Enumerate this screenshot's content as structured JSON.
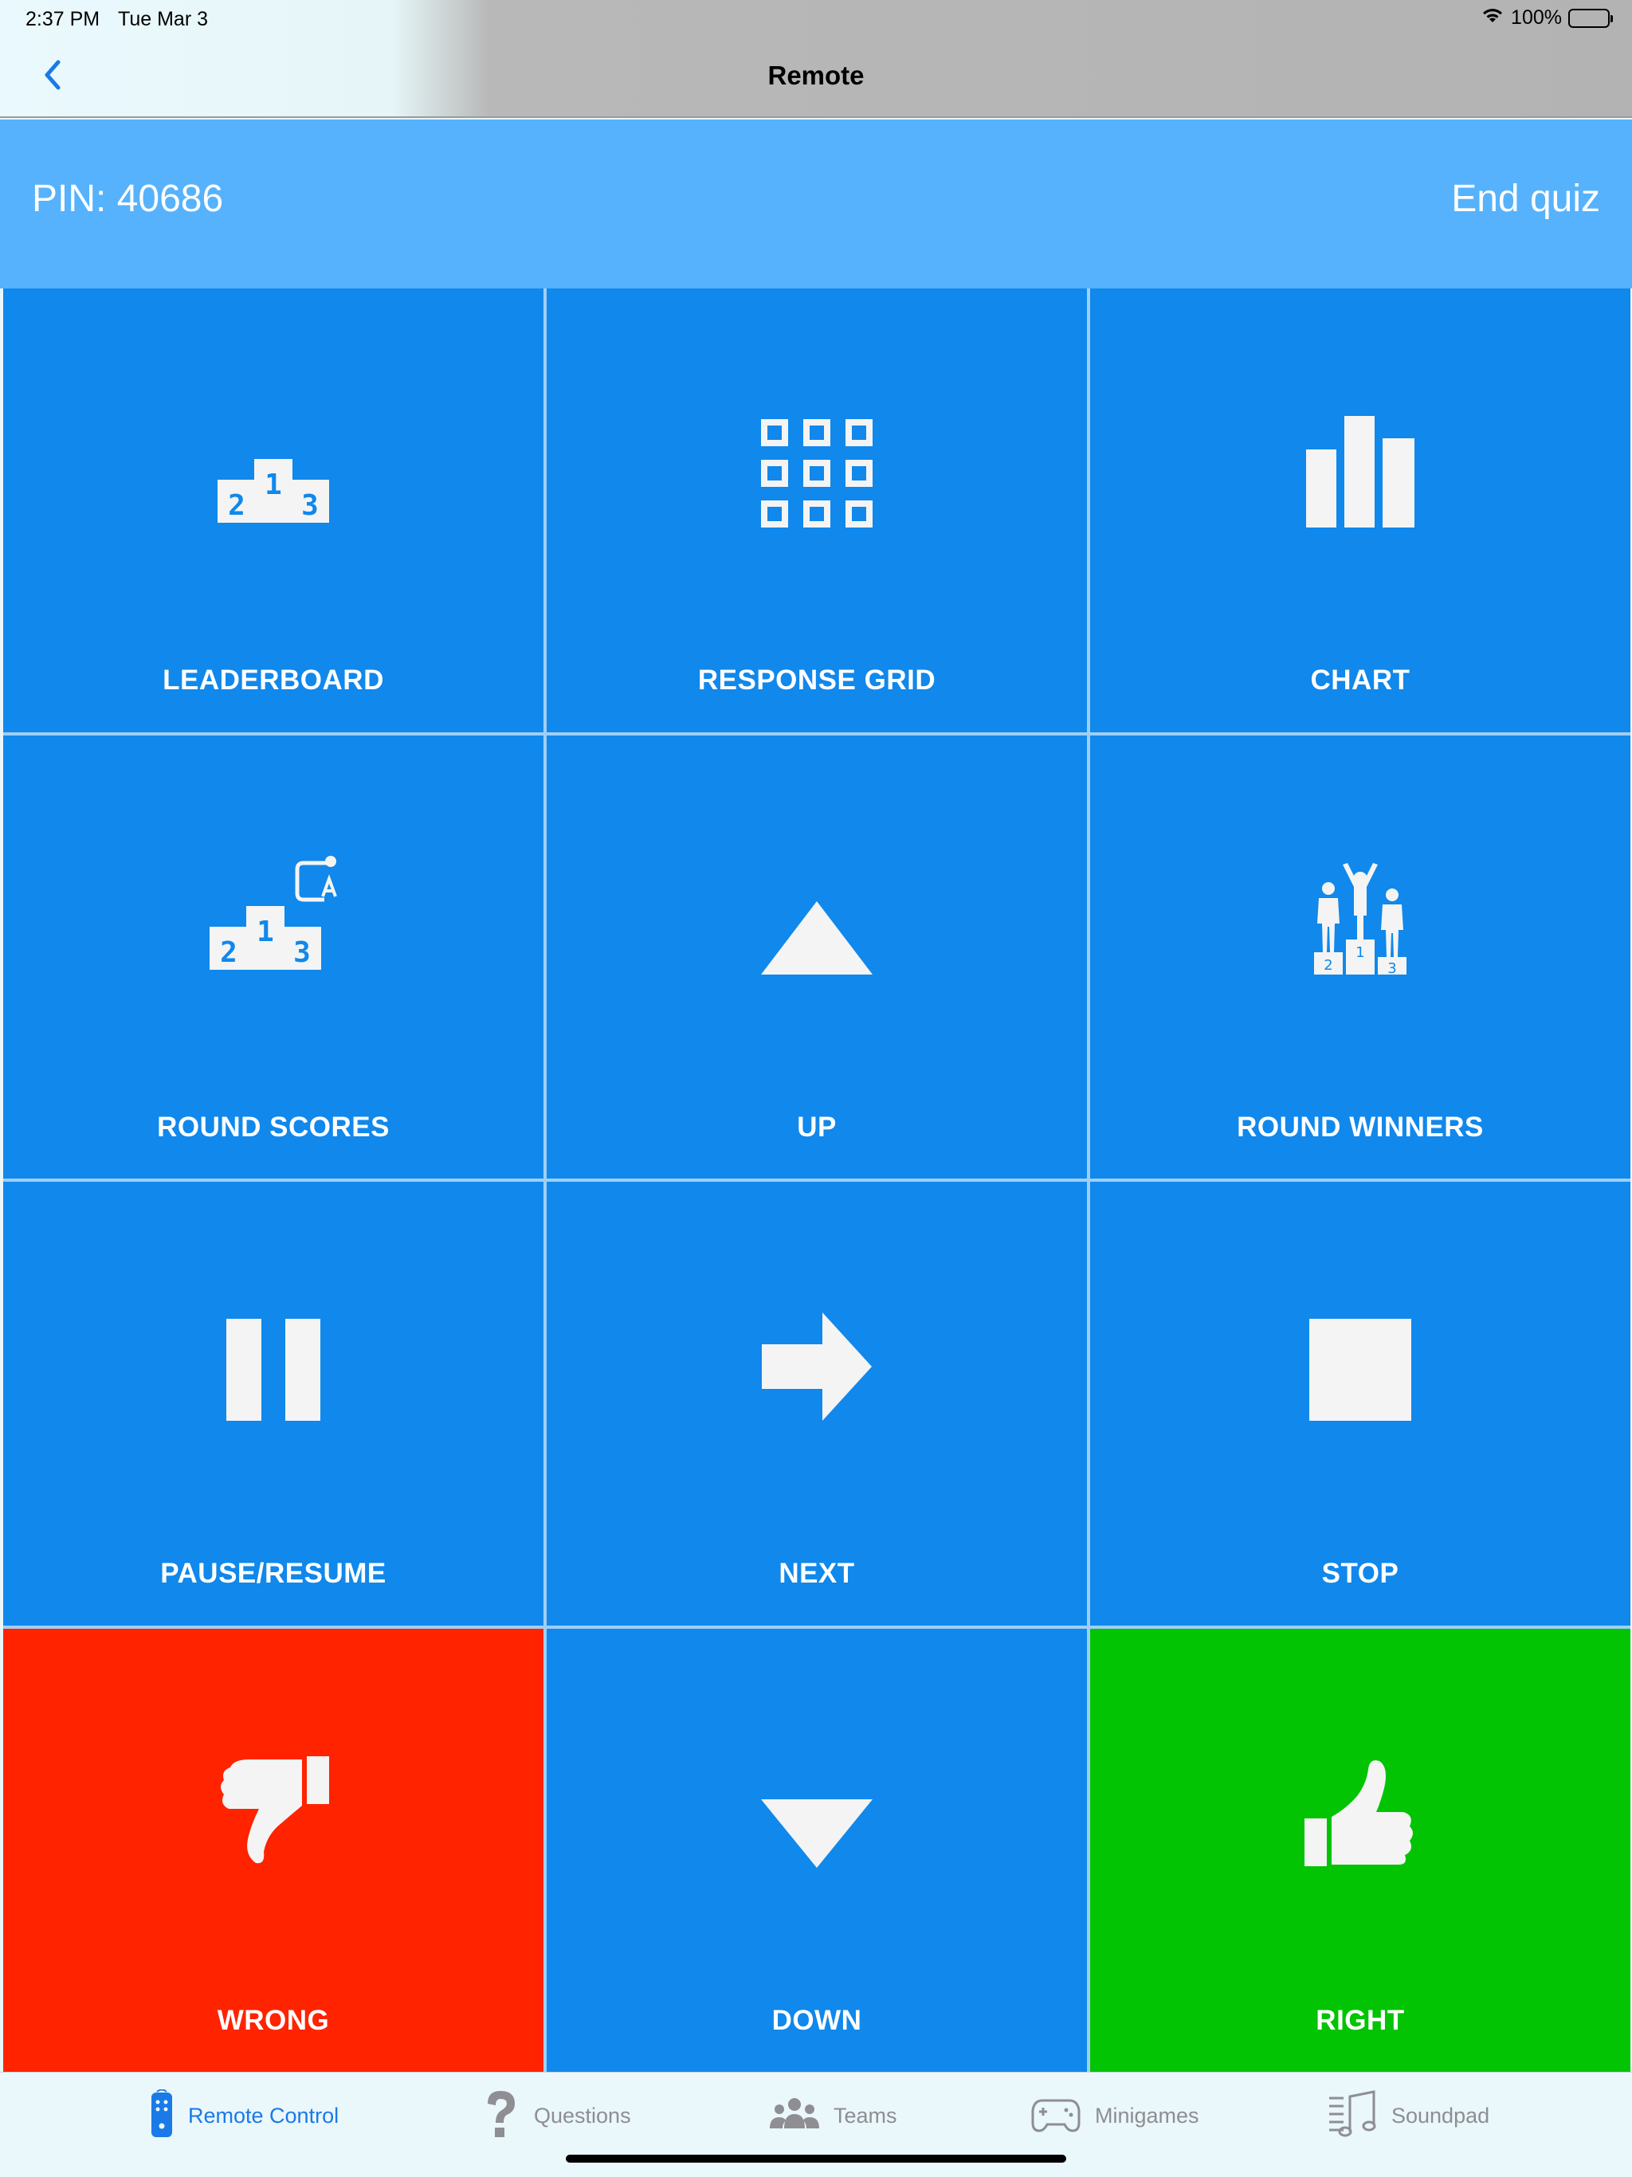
{
  "status": {
    "time": "2:37 PM",
    "date": "Tue Mar 3",
    "battery": "100%"
  },
  "nav": {
    "title": "Remote",
    "back_icon": "chevron-left-icon"
  },
  "header": {
    "pin": "PIN: 40686",
    "end_quiz": "End quiz"
  },
  "tiles": [
    {
      "label": "LEADERBOARD",
      "icon": "podium-icon",
      "color": "#1088ec"
    },
    {
      "label": "RESPONSE GRID",
      "icon": "grid-icon",
      "color": "#1088ec"
    },
    {
      "label": "CHART",
      "icon": "bar-chart-icon",
      "color": "#1088ec"
    },
    {
      "label": "ROUND SCORES",
      "icon": "round-podium-icon",
      "color": "#1088ec"
    },
    {
      "label": "UP",
      "icon": "triangle-up-icon",
      "color": "#1088ec"
    },
    {
      "label": "ROUND WINNERS",
      "icon": "winners-podium-icon",
      "color": "#1088ec"
    },
    {
      "label": "PAUSE/RESUME",
      "icon": "pause-icon",
      "color": "#1088ec"
    },
    {
      "label": "NEXT",
      "icon": "arrow-right-icon",
      "color": "#1088ec"
    },
    {
      "label": "STOP",
      "icon": "stop-icon",
      "color": "#1088ec"
    },
    {
      "label": "WRONG",
      "icon": "thumbs-down-icon",
      "color": "#ff2300"
    },
    {
      "label": "DOWN",
      "icon": "triangle-down-icon",
      "color": "#1088ec"
    },
    {
      "label": "RIGHT",
      "icon": "thumbs-up-icon",
      "color": "#03c403"
    }
  ],
  "podium_numbers": [
    "2",
    "1",
    "3"
  ],
  "tabs": [
    {
      "label": "Remote Control",
      "icon": "remote-icon",
      "active": true
    },
    {
      "label": "Questions",
      "icon": "question-icon",
      "active": false
    },
    {
      "label": "Teams",
      "icon": "people-icon",
      "active": false
    },
    {
      "label": "Minigames",
      "icon": "gamepad-icon",
      "active": false
    },
    {
      "label": "Soundpad",
      "icon": "music-note-icon",
      "active": false
    }
  ],
  "colors": {
    "tile_blue": "#1088ec",
    "wrong_red": "#ff2300",
    "right_green": "#03c403",
    "header_blue": "#56b2fc",
    "tab_active": "#1a7ae8",
    "tab_inactive": "#8e8e93"
  }
}
